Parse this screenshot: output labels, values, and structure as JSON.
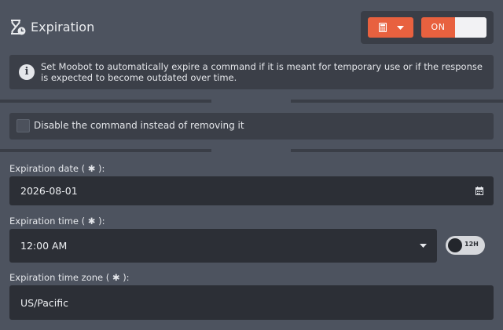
{
  "header": {
    "title": "Expiration",
    "title_icon": "hourglass-clock-icon",
    "calculator_icon": "calculator-icon",
    "toggle_label": "ON",
    "accent_color": "#e8613f"
  },
  "info": {
    "icon": "info-icon",
    "icon_glyph": "i",
    "text": "Set Moobot to automatically expire a command if it is meant for temporary use or if the response is expected to become outdated over time."
  },
  "disable_option": {
    "label": "Disable the command instead of removing it",
    "checked": false
  },
  "expiration_date": {
    "label": "Expiration date ( ✱ ):",
    "value": "2026-08-01",
    "icon": "calendar-icon"
  },
  "expiration_time": {
    "label": "Expiration time ( ✱ ):",
    "value": "12:00 AM",
    "icon": "caret-down-icon",
    "format_toggle": "12H"
  },
  "expiration_timezone": {
    "label": "Expiration time zone ( ✱ ):",
    "value": "US/Pacific"
  }
}
